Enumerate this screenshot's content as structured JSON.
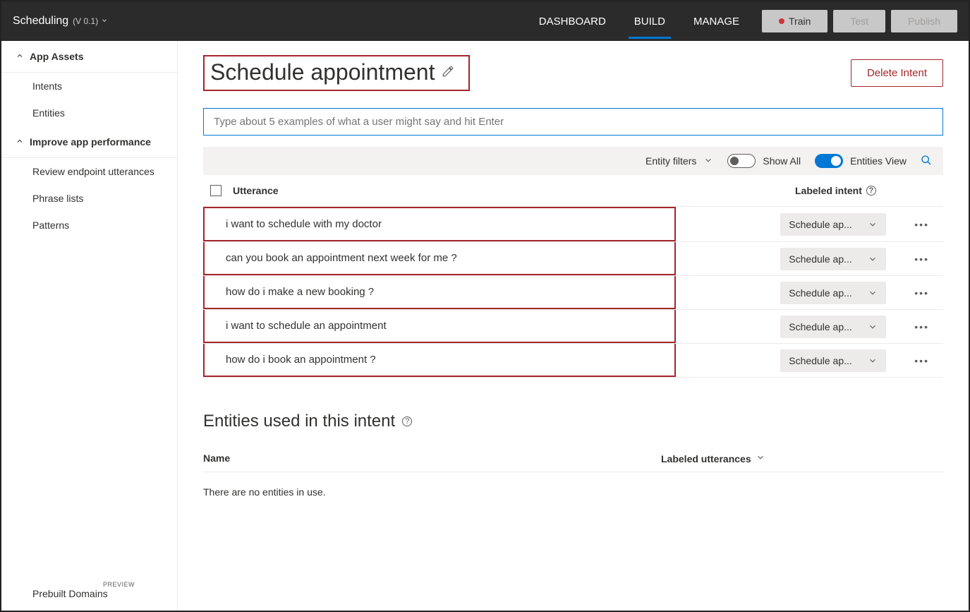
{
  "header": {
    "app_name": "Scheduling",
    "version": "(V 0.1)",
    "nav": {
      "dashboard": "DASHBOARD",
      "build": "BUILD",
      "manage": "MANAGE"
    },
    "buttons": {
      "train": "Train",
      "test": "Test",
      "publish": "Publish"
    }
  },
  "sidebar": {
    "section1": {
      "label": "App Assets",
      "items": [
        "Intents",
        "Entities"
      ]
    },
    "section2": {
      "label": "Improve app performance",
      "items": [
        "Review endpoint utterances",
        "Phrase lists",
        "Patterns"
      ]
    },
    "bottom": {
      "label": "Prebuilt Domains",
      "badge": "PREVIEW"
    }
  },
  "main": {
    "title": "Schedule appointment",
    "delete_label": "Delete Intent",
    "input_placeholder": "Type about 5 examples of what a user might say and hit Enter",
    "filter_bar": {
      "entity_filters": "Entity filters",
      "show_all": "Show All",
      "entities_view": "Entities View"
    },
    "table": {
      "col_utterance": "Utterance",
      "col_intent": "Labeled intent",
      "intent_label": "Schedule ap...",
      "rows": [
        "i want to schedule with my doctor",
        "can you book an appointment next week for me ?",
        "how do i make a new booking ?",
        "i want to schedule an appointment",
        "how do i book an appointment ?"
      ]
    },
    "entities_section": {
      "title": "Entities used in this intent",
      "col_name": "Name",
      "col_labeled": "Labeled utterances",
      "empty": "There are no entities in use."
    }
  }
}
